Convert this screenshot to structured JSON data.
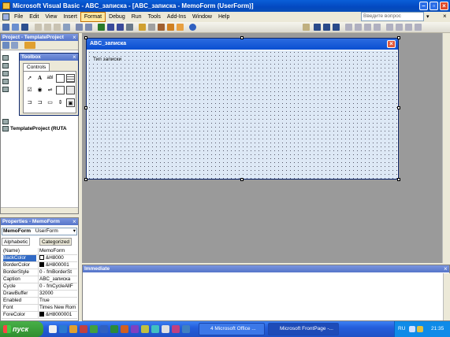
{
  "window": {
    "title": "Microsoft Visual Basic - ABC_записка - [ABC_записка - MemoForm (UserForm)]"
  },
  "menu": {
    "items": [
      "File",
      "Edit",
      "View",
      "Insert",
      "Format",
      "Debug",
      "Run",
      "Tools",
      "Add-Ins",
      "Window",
      "Help"
    ],
    "active": "Format",
    "help_placeholder": "Введите вопрос"
  },
  "project": {
    "title": "Project - TemplateProject",
    "template_project": "TemplateProject (RUTA"
  },
  "toolbox": {
    "title": "Toolbox",
    "tab": "Controls",
    "tool_icons": [
      "pointer-icon",
      "label-icon",
      "textbox-icon",
      "frame-icon",
      "combobox-icon",
      "listbox-icon",
      "checkbox-icon",
      "optionbutton-icon",
      "togglebutton-icon",
      "image-icon",
      "commandbutton-icon",
      "tabstrip-icon",
      "multipage-icon",
      "scrollbar-icon",
      "spinbutton-icon"
    ],
    "label_glyph": "A",
    "textbox_glyph": "abl"
  },
  "properties": {
    "title": "Properties - MemoForm",
    "object_name": "MemoForm",
    "object_type": "UserForm",
    "tabs": [
      "Alphabetic",
      "Categorized"
    ],
    "rows": [
      {
        "name": "(Name)",
        "value": "MemoForm"
      },
      {
        "name": "BackColor",
        "value": "&H8000",
        "swatch": "#ffffff",
        "selected": true
      },
      {
        "name": "BorderColor",
        "value": "&H800001",
        "swatch": "#000000"
      },
      {
        "name": "BorderStyle",
        "value": "0 - fmBorderSt"
      },
      {
        "name": "Caption",
        "value": "ABC_записка"
      },
      {
        "name": "Cycle",
        "value": "0 - fmCycleAllF"
      },
      {
        "name": "DrawBuffer",
        "value": "32000"
      },
      {
        "name": "Enabled",
        "value": "True"
      },
      {
        "name": "Font",
        "value": "Times New Rom"
      },
      {
        "name": "ForeColor",
        "value": "&H8000001",
        "swatch": "#000000"
      }
    ]
  },
  "form": {
    "title": "ABC_записка",
    "label": "Тип записки",
    "body_color": "#dde8f5"
  },
  "immediate": {
    "title": "Immediate"
  },
  "taskbar": {
    "start": "пуск",
    "tasks": [
      {
        "label": "4 Microsoft Office ...",
        "active": false
      },
      {
        "label": "Microsoft FrontPage -...",
        "active": true
      }
    ],
    "lang": "RU",
    "clock": "21:35"
  }
}
